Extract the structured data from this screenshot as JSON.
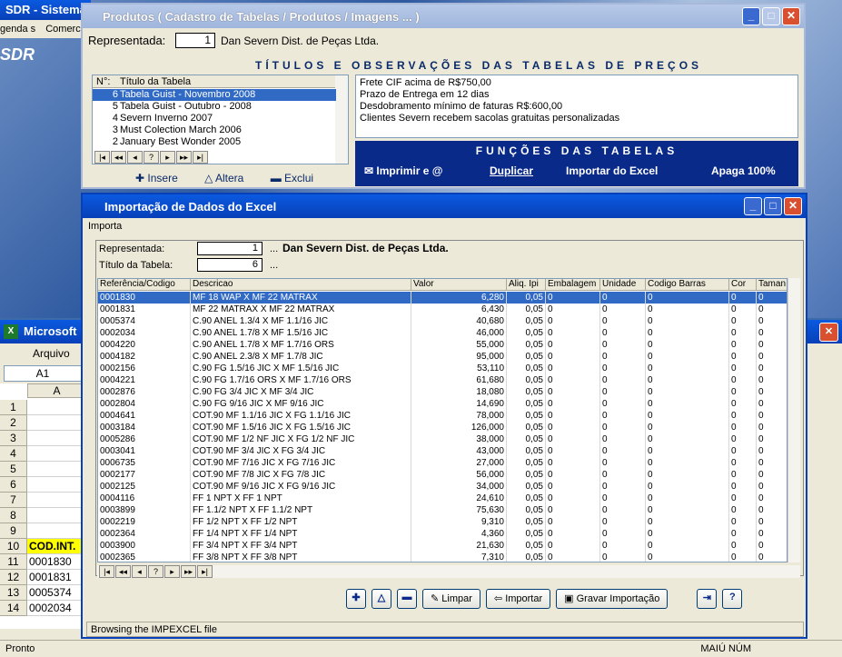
{
  "background_app": {
    "title": "SDR - Sistema",
    "menu": [
      "genda s",
      "Comerci"
    ],
    "logo": "SDR"
  },
  "excel": {
    "title": "Microsoft E",
    "menu_file": "Arquivo",
    "name_box": "A1",
    "col_header": "A",
    "row_numbers": [
      "1",
      "2",
      "3",
      "4",
      "5",
      "6",
      "7",
      "8",
      "9",
      "10",
      "11",
      "12",
      "13",
      "14"
    ],
    "cells": {
      "10": "COD.INT.",
      "11": "0001830",
      "12": "0001831",
      "13": "0005374",
      "14": "0002034"
    },
    "status_left": "Pronto",
    "status_right": "MAIÚ NÚM"
  },
  "produtos": {
    "title": "Produtos ( Cadastro de Tabelas / Produtos / Imagens ... )",
    "rep_label": "Representada:",
    "rep_value": "1",
    "rep_name": "Dan Severn Dist. de Peças Ltda.",
    "section_title": "TÍTULOS E OBSERVAÇÕES DAS TABELAS DE PREÇOS",
    "list_headers": [
      "N°:",
      "Título da Tabela"
    ],
    "list_rows": [
      {
        "n": "6",
        "t": "Tabela Guist - Novembro 2008"
      },
      {
        "n": "5",
        "t": "Tabela Guist - Outubro - 2008"
      },
      {
        "n": "4",
        "t": "Severn Inverno 2007"
      },
      {
        "n": "3",
        "t": "Must Colection March 2006"
      },
      {
        "n": "2",
        "t": "January Best Wonder 2005"
      }
    ],
    "obs_lines": [
      "Frete CIF acima de R$750,00",
      "Prazo de Entrega em 12 dias",
      "Desdobramento mínimo de faturas R$:600,00",
      "Clientes Severn recebem sacolas gratuitas personalizadas"
    ],
    "funcs_title": "FUNÇÕES DAS TABELAS",
    "funcs": [
      "Imprimir e @",
      "Duplicar",
      "Importar do Excel",
      "Apaga 100%"
    ],
    "actions": [
      "Insere",
      "Altera",
      "Exclui"
    ]
  },
  "importacao": {
    "title": "Importação de Dados do Excel",
    "menu": "Importa",
    "rep_label": "Representada:",
    "rep_value": "1",
    "rep_name": "Dan Severn Dist. de Peças Ltda.",
    "tab_label": "Título da Tabela:",
    "tab_value": "6",
    "ellipsis": "...",
    "headers": [
      "Referência/Codigo",
      "Descricao",
      "Valor",
      "Aliq. Ipi",
      "Embalagem",
      "Unidade",
      "Codigo Barras",
      "Cor",
      "Taman"
    ],
    "rows": [
      [
        "0001830",
        "MF 18 WAP X MF 22 MATRAX",
        "6,280",
        "0,05",
        "0",
        "0",
        "0",
        "0",
        "0"
      ],
      [
        "0001831",
        "MF 22 MATRAX X MF 22 MATRAX",
        "6,430",
        "0,05",
        "0",
        "0",
        "0",
        "0",
        "0"
      ],
      [
        "0005374",
        "C.90 ANEL 1.3/4 X MF 1.1/16 JIC",
        "40,680",
        "0,05",
        "0",
        "0",
        "0",
        "0",
        "0"
      ],
      [
        "0002034",
        "C.90 ANEL 1.7/8 X MF 1.5/16 JIC",
        "46,000",
        "0,05",
        "0",
        "0",
        "0",
        "0",
        "0"
      ],
      [
        "0004220",
        "C.90 ANEL 1.7/8 X MF 1.7/16 ORS",
        "55,000",
        "0,05",
        "0",
        "0",
        "0",
        "0",
        "0"
      ],
      [
        "0004182",
        "C.90 ANEL 2.3/8 X MF 1.7/8 JIC",
        "95,000",
        "0,05",
        "0",
        "0",
        "0",
        "0",
        "0"
      ],
      [
        "0002156",
        "C.90 FG 1.5/16 JIC X MF 1.5/16 JIC",
        "53,110",
        "0,05",
        "0",
        "0",
        "0",
        "0",
        "0"
      ],
      [
        "0004221",
        "C.90 FG 1.7/16 ORS X MF 1.7/16 ORS",
        "61,680",
        "0,05",
        "0",
        "0",
        "0",
        "0",
        "0"
      ],
      [
        "0002876",
        "C.90 FG 3/4 JIC X MF 3/4 JIC",
        "18,080",
        "0,05",
        "0",
        "0",
        "0",
        "0",
        "0"
      ],
      [
        "0002804",
        "C.90 FG 9/16 JIC X MF 9/16 JIC",
        "14,690",
        "0,05",
        "0",
        "0",
        "0",
        "0",
        "0"
      ],
      [
        "0004641",
        "COT.90 MF 1.1/16 JIC X FG 1.1/16 JIC",
        "78,000",
        "0,05",
        "0",
        "0",
        "0",
        "0",
        "0"
      ],
      [
        "0003184",
        "COT.90 MF 1.5/16 JIC X FG 1.5/16 JIC",
        "126,000",
        "0,05",
        "0",
        "0",
        "0",
        "0",
        "0"
      ],
      [
        "0005286",
        "COT.90 MF 1/2 NF JIC X FG 1/2 NF JIC",
        "38,000",
        "0,05",
        "0",
        "0",
        "0",
        "0",
        "0"
      ],
      [
        "0003041",
        "COT.90 MF 3/4 JIC X FG 3/4 JIC",
        "43,000",
        "0,05",
        "0",
        "0",
        "0",
        "0",
        "0"
      ],
      [
        "0006735",
        "COT.90 MF 7/16 JIC X FG 7/16 JIC",
        "27,000",
        "0,05",
        "0",
        "0",
        "0",
        "0",
        "0"
      ],
      [
        "0002177",
        "COT.90 MF 7/8 JIC X FG 7/8 JIC",
        "56,000",
        "0,05",
        "0",
        "0",
        "0",
        "0",
        "0"
      ],
      [
        "0002125",
        "COT.90 MF 9/16 JIC X FG 9/16 JIC",
        "34,000",
        "0,05",
        "0",
        "0",
        "0",
        "0",
        "0"
      ],
      [
        "0004116",
        "FF 1 NPT X FF 1 NPT",
        "24,610",
        "0,05",
        "0",
        "0",
        "0",
        "0",
        "0"
      ],
      [
        "0003899",
        "FF 1.1/2 NPT X FF 1.1/2 NPT",
        "75,630",
        "0,05",
        "0",
        "0",
        "0",
        "0",
        "0"
      ],
      [
        "0002219",
        "FF 1/2 NPT X FF 1/2 NPT",
        "9,310",
        "0,05",
        "0",
        "0",
        "0",
        "0",
        "0"
      ],
      [
        "0002364",
        "FF 1/4 NPT X FF 1/4 NPT",
        "4,360",
        "0,05",
        "0",
        "0",
        "0",
        "0",
        "0"
      ],
      [
        "0003900",
        "FF 3/4 NPT X FF 3/4 NPT",
        "21,630",
        "0,05",
        "0",
        "0",
        "0",
        "0",
        "0"
      ],
      [
        "0002365",
        "FF 3/8 NPT X FF 3/8 NPT",
        "7,310",
        "0,05",
        "0",
        "0",
        "0",
        "0",
        "0"
      ]
    ],
    "buttons": [
      "Limpar",
      "Importar",
      "Gravar Importação"
    ],
    "status": "Browsing the IMPEXCEL file"
  }
}
